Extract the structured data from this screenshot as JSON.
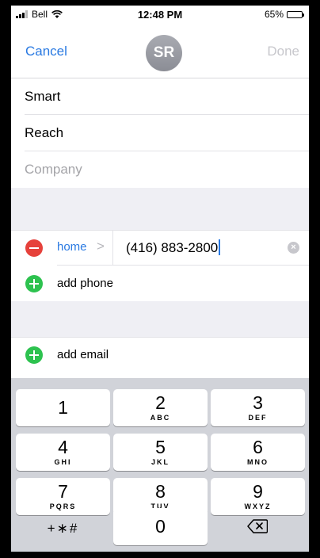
{
  "status": {
    "carrier": "Bell",
    "time": "12:48 PM",
    "battery": "65%",
    "battery_level": 0.65
  },
  "nav": {
    "cancel": "Cancel",
    "initials": "SR",
    "done": "Done"
  },
  "fields": {
    "first_name": "Smart",
    "last_name": "Reach",
    "company_placeholder": "Company"
  },
  "phone": {
    "label": "home",
    "chevron": ">",
    "number": "(416) 883-2800",
    "clear": "×"
  },
  "add_phone": "add phone",
  "add_email": "add email",
  "keypad": {
    "keys": [
      {
        "digit": "1",
        "letters": ""
      },
      {
        "digit": "2",
        "letters": "ABC"
      },
      {
        "digit": "3",
        "letters": "DEF"
      },
      {
        "digit": "4",
        "letters": "GHI"
      },
      {
        "digit": "5",
        "letters": "JKL"
      },
      {
        "digit": "6",
        "letters": "MNO"
      },
      {
        "digit": "7",
        "letters": "PQRS"
      },
      {
        "digit": "8",
        "letters": "TUV"
      },
      {
        "digit": "9",
        "letters": "WXYZ"
      }
    ],
    "symbols": "+∗#",
    "zero": "0"
  },
  "colors": {
    "accent": "#2a7ae2",
    "delete_red": "#e6413b",
    "add_green": "#2dc24f"
  }
}
